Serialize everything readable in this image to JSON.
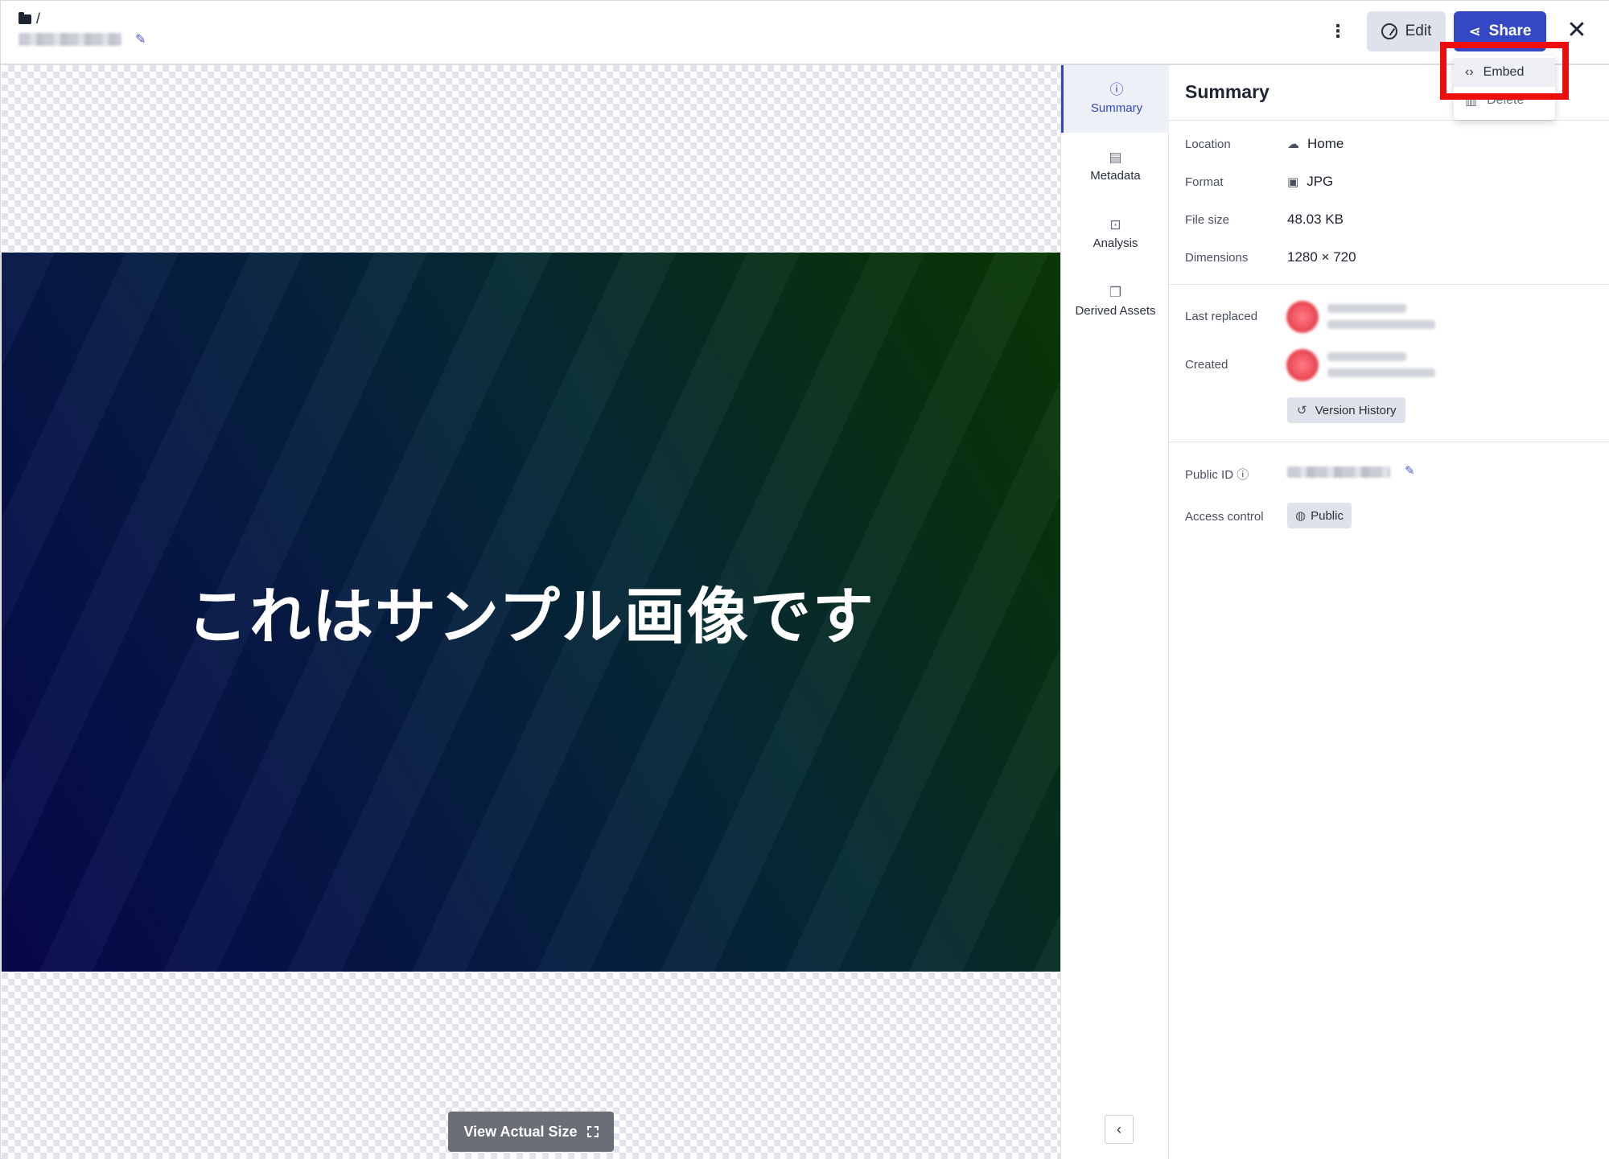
{
  "header": {
    "breadcrumb": "/",
    "actions": {
      "more_label": "⋮",
      "edit_label": "Edit",
      "share_label": "Share",
      "close_label": "✕"
    }
  },
  "share_menu": {
    "items": [
      {
        "label": "Embed",
        "icon": "code-icon"
      },
      {
        "label": "Delete",
        "icon": "trash-icon"
      }
    ]
  },
  "preview": {
    "image_text": "これはサンプル画像です",
    "view_actual_size_label": "View Actual Size"
  },
  "tabs": [
    {
      "label": "Summary",
      "icon": "info-icon",
      "active": true
    },
    {
      "label": "Metadata",
      "icon": "document-icon",
      "active": false
    },
    {
      "label": "Analysis",
      "icon": "analysis-icon",
      "active": false
    },
    {
      "label": "Derived Assets",
      "icon": "layers-icon",
      "active": false
    }
  ],
  "summary": {
    "title": "Summary",
    "location": {
      "label": "Location",
      "value": "Home"
    },
    "format": {
      "label": "Format",
      "value": "JPG"
    },
    "file_size": {
      "label": "File size",
      "value": "48.03 KB"
    },
    "dimensions": {
      "label": "Dimensions",
      "value": "1280 × 720"
    },
    "last_replaced": {
      "label": "Last replaced"
    },
    "created": {
      "label": "Created"
    },
    "version_history_label": "Version History",
    "public_id": {
      "label": "Public ID"
    },
    "access_control": {
      "label": "Access control",
      "value": "Public"
    }
  },
  "colors": {
    "accent": "#3448c5",
    "highlight": "#ee0d0d"
  }
}
